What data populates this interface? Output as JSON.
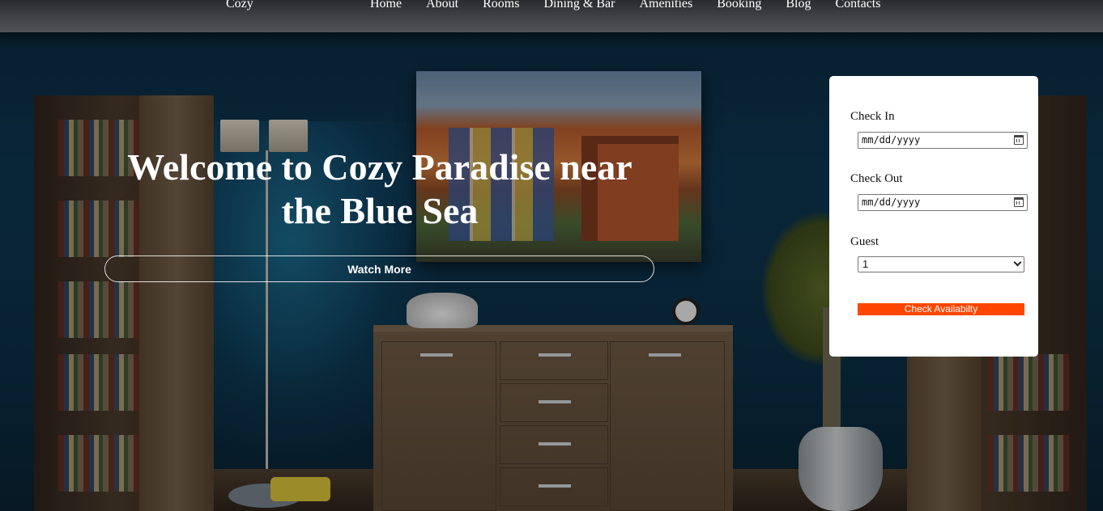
{
  "nav": {
    "brand": "Cozy",
    "items": [
      {
        "label": "Home"
      },
      {
        "label": "About"
      },
      {
        "label": "Rooms"
      },
      {
        "label": "Dining & Bar"
      },
      {
        "label": "Amenities"
      },
      {
        "label": "Booking"
      },
      {
        "label": "Blog"
      },
      {
        "label": "Contacts"
      }
    ]
  },
  "hero": {
    "title_line1": "Welcome to Cozy Paradise near",
    "title_line2": "the Blue Sea",
    "button_label": "Watch More"
  },
  "booking": {
    "check_in_label": "Check In",
    "check_in_value": "mm/dd/yyyy",
    "check_out_label": "Check Out",
    "check_out_value": "mm/dd/yyyy",
    "guest_label": "Guest",
    "guest_value": "1",
    "submit_label": "Check Availabilty"
  },
  "colors": {
    "accent": "#ff4500",
    "panel": "#ffffff",
    "text_light": "#ffffff"
  }
}
